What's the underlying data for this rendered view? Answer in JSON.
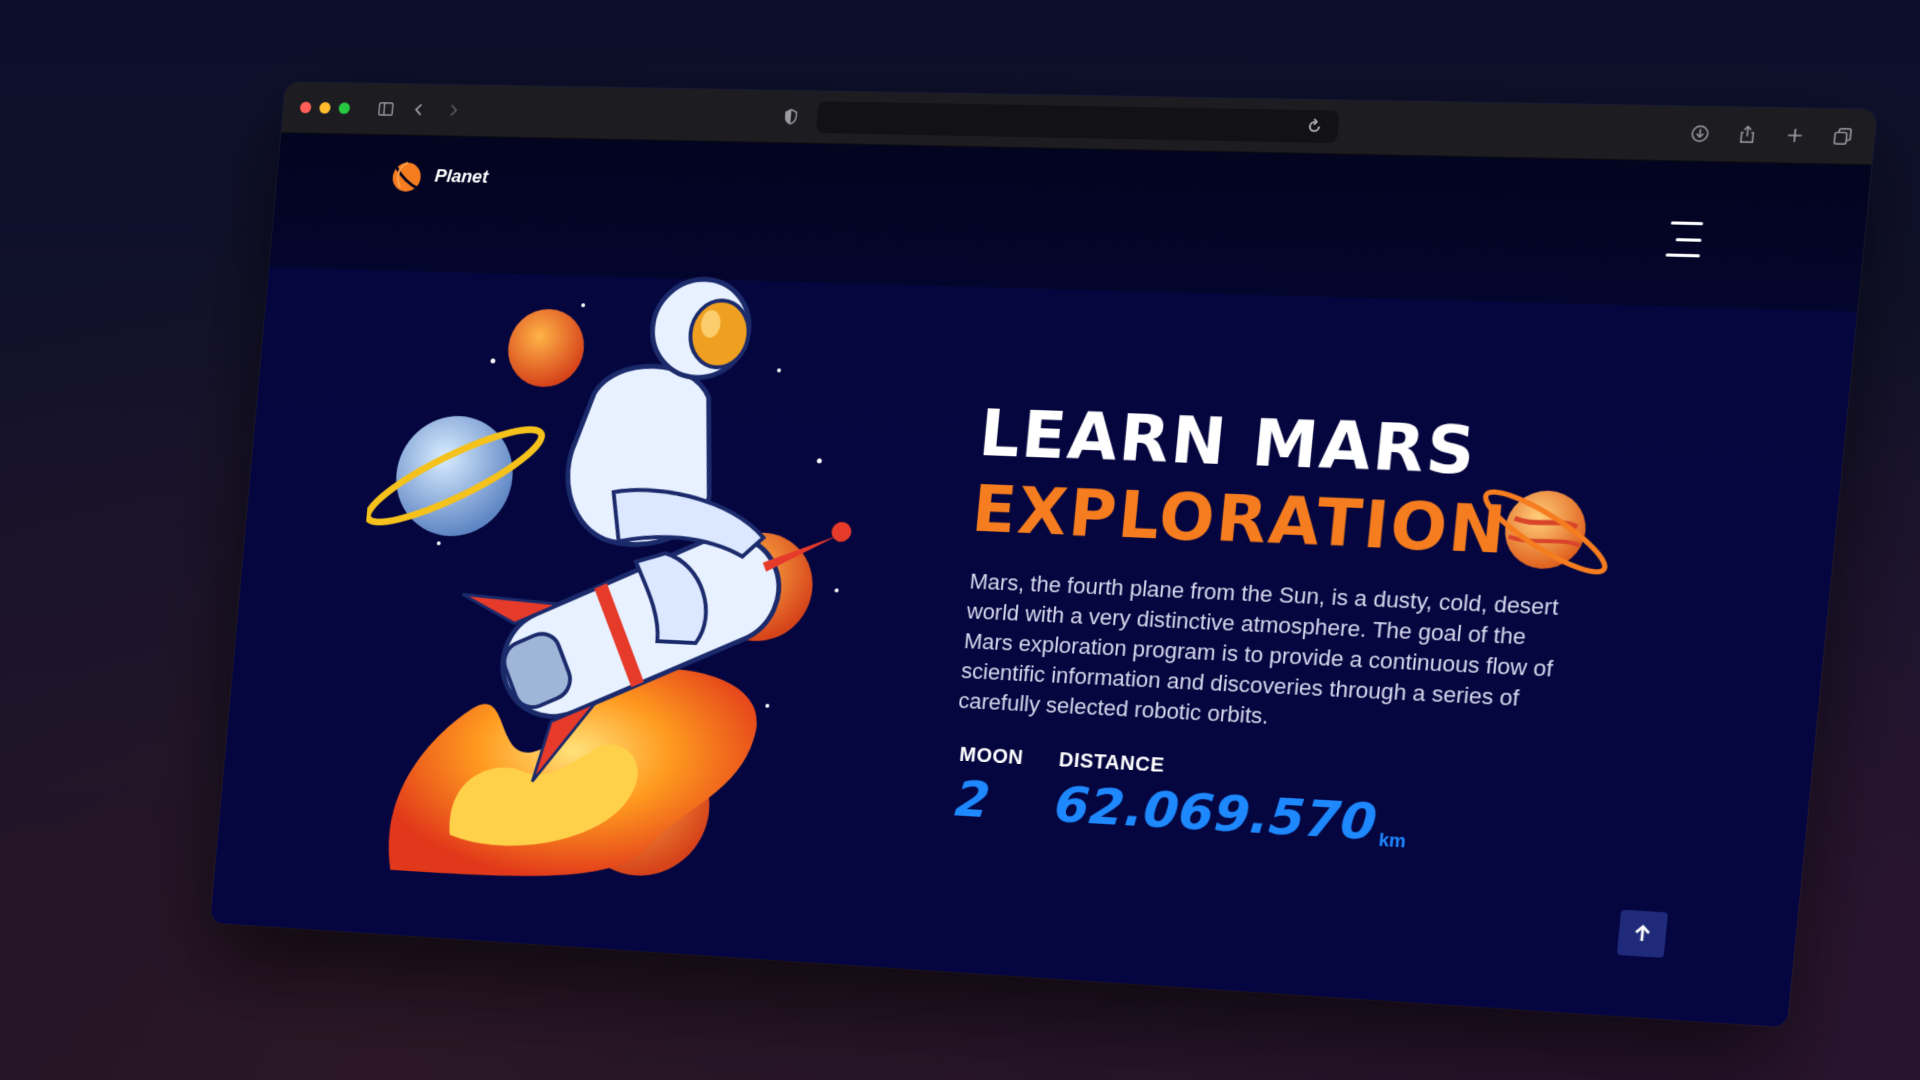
{
  "browser": {
    "traffic_lights": {
      "close": "#ff5f57",
      "minimize": "#febc2e",
      "zoom": "#28c840"
    }
  },
  "site": {
    "brand_name": "Planet",
    "accent_orange": "#f57c1f",
    "accent_blue": "#1e88ff"
  },
  "hero": {
    "title_line1": "LEARN MARS",
    "title_line2": "EXPLORATION",
    "description": "Mars, the fourth plane from the Sun, is a dusty, cold, desert world with a very distinctive atmosphere. The goal of the Mars exploration program is to provide a continuous flow of scientific information and discoveries through a series of carefully selected robotic orbits."
  },
  "stats": {
    "moon_label": "MOON",
    "moon_value": "2",
    "distance_label": "DISTANCE",
    "distance_value": "62.069.570",
    "distance_unit": "km"
  },
  "icons": {
    "menu": "hamburger-menu-icon",
    "scroll_top": "arrow-up-icon"
  }
}
